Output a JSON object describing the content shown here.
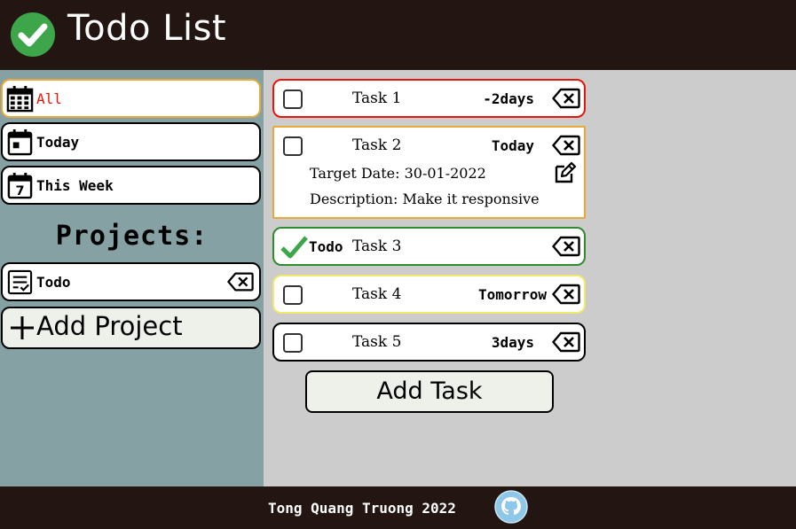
{
  "app": {
    "title": "Todo List"
  },
  "colors": {
    "header_bg": "#221512",
    "sidebar_bg": "#86a1a3",
    "main_bg": "#cccccc",
    "active_nav_text": "#e8140a",
    "active_nav_border": "#e8a83a",
    "check_green": "#3da64b"
  },
  "sidebar": {
    "nav": [
      {
        "label": "All",
        "icon": "calendar-grid-icon",
        "active": true
      },
      {
        "label": "Today",
        "icon": "calendar-day-icon",
        "active": false
      },
      {
        "label": "This Week",
        "icon": "calendar-week-icon",
        "active": false
      }
    ],
    "projects_heading": "Projects:",
    "projects": [
      {
        "label": "Todo",
        "icon": "checklist-icon"
      }
    ],
    "add_project_label": "Add Project"
  },
  "tasks": [
    {
      "name": "Task 1",
      "due": "-2days",
      "status": "overdue",
      "border": "#e8140a",
      "completed": false
    },
    {
      "name": "Task 2",
      "due": "Today",
      "status": "today",
      "border": "#e8a83a",
      "completed": false,
      "target_date": "Target Date: 30-01-2022",
      "description": "Description: Make it responsive"
    },
    {
      "name": "Task 3",
      "project": "Todo",
      "due": "",
      "status": "completed",
      "border": "#2e8b2e",
      "completed": true
    },
    {
      "name": "Task 4",
      "due": "Tomorrow",
      "status": "tomorrow",
      "border": "#f1e96a",
      "completed": false
    },
    {
      "name": "Task 5",
      "due": "3days",
      "status": "upcoming",
      "border": "#000000",
      "completed": false
    }
  ],
  "add_task_label": "Add Task",
  "footer": {
    "credit": "Tong Quang Truong 2022",
    "icon": "github-icon"
  }
}
